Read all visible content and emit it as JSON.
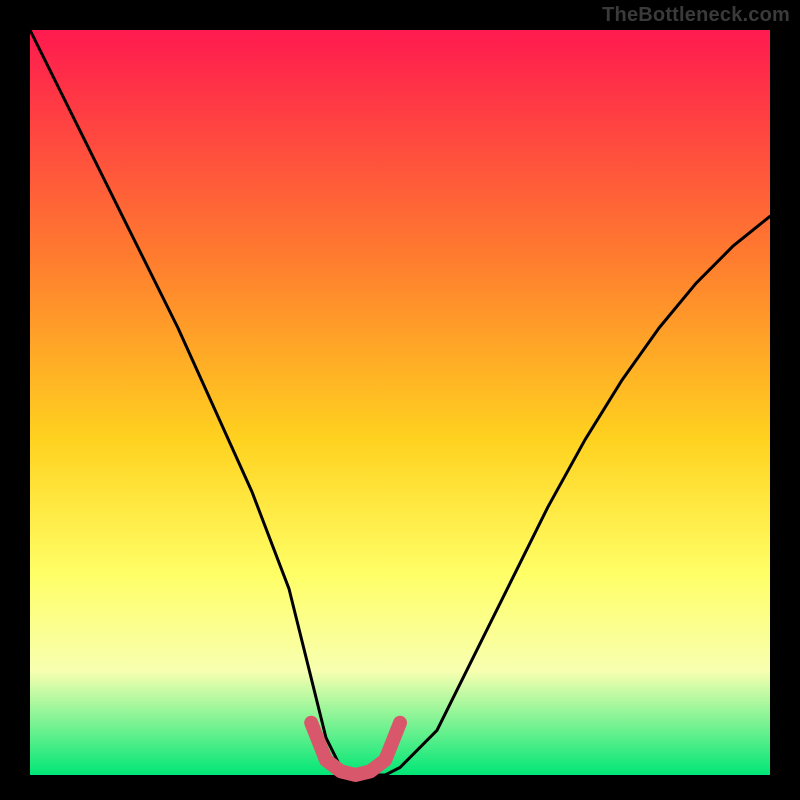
{
  "watermark": "TheBottleneck.com",
  "colors": {
    "frame": "#000000",
    "grad_top": "#ff1a4f",
    "grad_mid1": "#ff7a2f",
    "grad_mid2": "#ffd21f",
    "grad_mid3": "#ffff66",
    "grad_mid4": "#f8ffb0",
    "grad_bottom": "#00e676",
    "curve": "#000000",
    "highlight": "#d9576b"
  },
  "chart_data": {
    "type": "line",
    "title": "",
    "xlabel": "",
    "ylabel": "",
    "x_range": [
      0,
      100
    ],
    "y_range": [
      0,
      100
    ],
    "series": [
      {
        "name": "bottleneck-curve",
        "x": [
          0,
          5,
          10,
          15,
          20,
          25,
          30,
          35,
          38,
          40,
          42,
          44,
          46,
          48,
          50,
          55,
          60,
          65,
          70,
          75,
          80,
          85,
          90,
          95,
          100
        ],
        "y": [
          100,
          90,
          80,
          70,
          60,
          49,
          38,
          25,
          13,
          5,
          1,
          0,
          0,
          0,
          1,
          6,
          16,
          26,
          36,
          45,
          53,
          60,
          66,
          71,
          75
        ]
      },
      {
        "name": "valley-highlight",
        "x": [
          38,
          40,
          42,
          44,
          46,
          48,
          50
        ],
        "y": [
          7,
          2,
          0.5,
          0,
          0.5,
          2,
          7
        ]
      }
    ],
    "notes": "Background is a vertical rainbow gradient from red (top) through orange/yellow to green (bottom). Axes have no ticks, labels, or explicit units; values are approximate proportions read from pixel geometry."
  }
}
